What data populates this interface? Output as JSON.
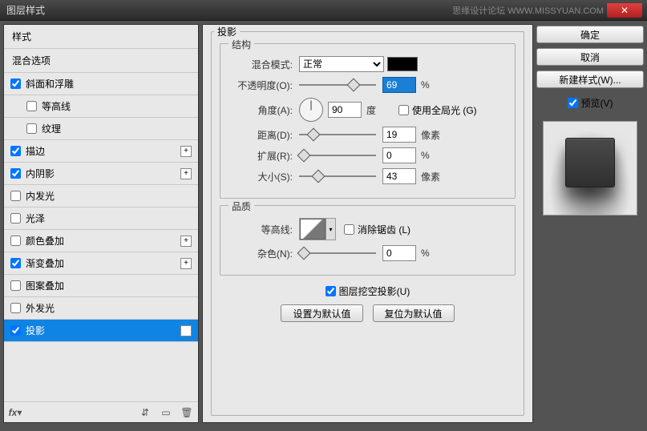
{
  "window": {
    "title": "图层样式",
    "watermark": "思缘设计论坛  WWW.MISSYUAN.COM"
  },
  "left": {
    "header": "样式",
    "blending": "混合选项",
    "items": [
      {
        "label": "斜面和浮雕",
        "checked": true,
        "plus": false,
        "indent": false
      },
      {
        "label": "等高线",
        "checked": false,
        "plus": false,
        "indent": true
      },
      {
        "label": "纹理",
        "checked": false,
        "plus": false,
        "indent": true
      },
      {
        "label": "描边",
        "checked": true,
        "plus": true,
        "indent": false
      },
      {
        "label": "内阴影",
        "checked": true,
        "plus": true,
        "indent": false
      },
      {
        "label": "内发光",
        "checked": false,
        "plus": false,
        "indent": false
      },
      {
        "label": "光泽",
        "checked": false,
        "plus": false,
        "indent": false
      },
      {
        "label": "颜色叠加",
        "checked": false,
        "plus": true,
        "indent": false
      },
      {
        "label": "渐变叠加",
        "checked": true,
        "plus": true,
        "indent": false
      },
      {
        "label": "图案叠加",
        "checked": false,
        "plus": false,
        "indent": false
      },
      {
        "label": "外发光",
        "checked": false,
        "plus": false,
        "indent": false
      },
      {
        "label": "投影",
        "checked": true,
        "plus": true,
        "indent": false,
        "selected": true
      }
    ],
    "footer_fx": "fx"
  },
  "center": {
    "title": "投影",
    "structure": {
      "legend": "结构",
      "blendmode_label": "混合模式:",
      "blendmode_value": "正常",
      "opacity_label": "不透明度(O):",
      "opacity_value": "69",
      "opacity_unit": "%",
      "angle_label": "角度(A):",
      "angle_value": "90",
      "angle_unit": "度",
      "global_label": "使用全局光 (G)",
      "global_checked": false,
      "distance_label": "距离(D):",
      "distance_value": "19",
      "distance_unit": "像素",
      "spread_label": "扩展(R):",
      "spread_value": "0",
      "spread_unit": "%",
      "size_label": "大小(S):",
      "size_value": "43",
      "size_unit": "像素"
    },
    "quality": {
      "legend": "品质",
      "contour_label": "等高线:",
      "antialias_label": "消除锯齿 (L)",
      "antialias_checked": false,
      "noise_label": "杂色(N):",
      "noise_value": "0",
      "noise_unit": "%"
    },
    "knockout_label": "图层挖空投影(U)",
    "knockout_checked": true,
    "btn_default": "设置为默认值",
    "btn_reset": "复位为默认值"
  },
  "right": {
    "ok": "确定",
    "cancel": "取消",
    "newstyle": "新建样式(W)...",
    "preview_label": "预览(V)",
    "preview_checked": true
  }
}
